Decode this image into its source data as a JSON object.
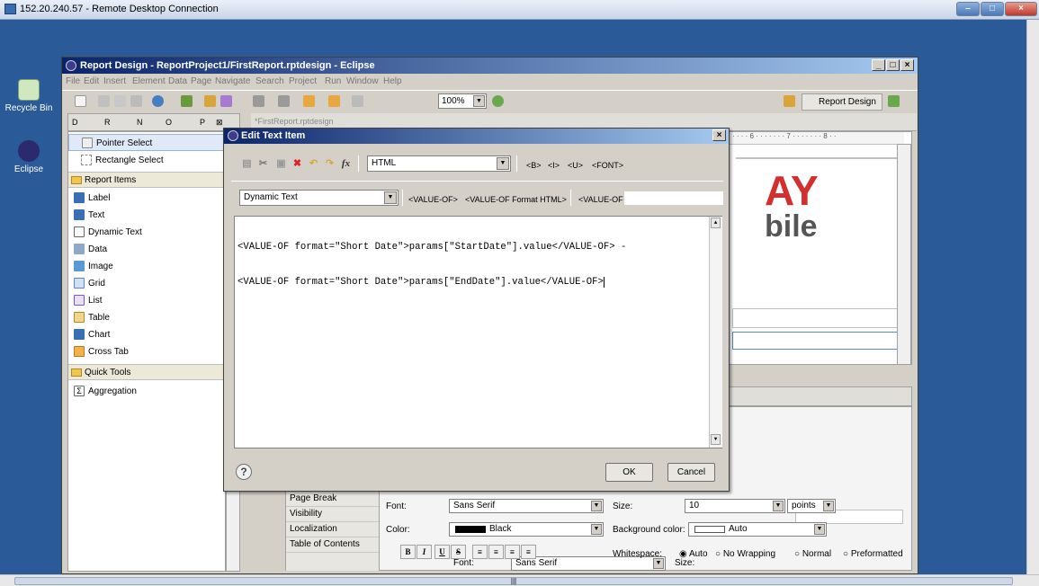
{
  "rdp": {
    "title": "152.20.240.57 - Remote Desktop Connection"
  },
  "desktop": {
    "icons": [
      {
        "label": "Recycle Bin"
      },
      {
        "label": "Eclipse"
      }
    ]
  },
  "eclipse": {
    "title": "Report Design - ReportProject1/FirstReport.rptdesign - Eclipse",
    "menu": [
      "File",
      "Edit",
      "Insert",
      "Element",
      "Data",
      "Page",
      "Navigate",
      "Search",
      "Project",
      "Run",
      "Window",
      "Help"
    ],
    "zoom": "100%",
    "perspective": "Report Design",
    "palette_tabs": [
      "D",
      "R",
      "N",
      "O",
      "P"
    ],
    "palette": {
      "tools": [
        "Pointer Select",
        "Rectangle Select"
      ],
      "report_items_label": "Report Items",
      "report_items": [
        "Label",
        "Text",
        "Dynamic Text",
        "Data",
        "Image",
        "Grid",
        "List",
        "Table",
        "Chart",
        "Cross Tab"
      ],
      "quick_tools_label": "Quick Tools",
      "quick_tools": [
        "Aggregation"
      ]
    },
    "editor_tab": "*FirstReport.rptdesign",
    "properties": {
      "categories": [
        "Page Break",
        "Visibility",
        "Localization",
        "Table of Contents"
      ],
      "font_label": "Font:",
      "font_value": "Sans Serif",
      "size_label": "Size:",
      "size_value": "10",
      "size_unit": "points",
      "color_label": "Color:",
      "color_value": "Black",
      "bgcolor_label": "Background color:",
      "bgcolor_value": "Auto",
      "whitespace_label": "Whitespace:",
      "whitespace_options": [
        "Auto",
        "No Wrapping",
        "Normal",
        "Preformatted"
      ]
    }
  },
  "dialog": {
    "title": "Edit Text Item",
    "content_type": "HTML",
    "tag_buttons": [
      "<B>",
      "<I>",
      "<U>",
      "<FONT>"
    ],
    "dynamic_combo": "Dynamic Text",
    "insert_buttons": [
      "<VALUE-OF>",
      "<VALUE-OF Format HTML>",
      "<VALUE-OF"
    ],
    "text_lines": [
      "<VALUE-OF format=\"Short Date\">params[\"StartDate\"].value</VALUE-OF> -",
      "<VALUE-OF format=\"Short Date\">params[\"EndDate\"].value</VALUE-OF>"
    ],
    "ok_label": "OK",
    "cancel_label": "Cancel",
    "help_glyph": "?"
  },
  "colors": {
    "title_start": "#0a246a",
    "title_end": "#a6caf0",
    "desktop": "#2b5a99",
    "logo_red": "#d32f2f"
  }
}
